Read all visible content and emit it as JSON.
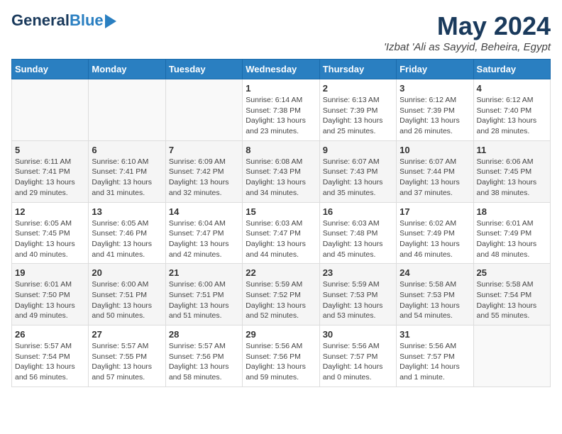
{
  "header": {
    "logo_general": "General",
    "logo_blue": "Blue",
    "month": "May 2024",
    "location": "'Izbat 'Ali as Sayyid, Beheira, Egypt"
  },
  "days_of_week": [
    "Sunday",
    "Monday",
    "Tuesday",
    "Wednesday",
    "Thursday",
    "Friday",
    "Saturday"
  ],
  "weeks": [
    [
      {
        "day": "",
        "info": ""
      },
      {
        "day": "",
        "info": ""
      },
      {
        "day": "",
        "info": ""
      },
      {
        "day": "1",
        "info": "Sunrise: 6:14 AM\nSunset: 7:38 PM\nDaylight: 13 hours\nand 23 minutes."
      },
      {
        "day": "2",
        "info": "Sunrise: 6:13 AM\nSunset: 7:39 PM\nDaylight: 13 hours\nand 25 minutes."
      },
      {
        "day": "3",
        "info": "Sunrise: 6:12 AM\nSunset: 7:39 PM\nDaylight: 13 hours\nand 26 minutes."
      },
      {
        "day": "4",
        "info": "Sunrise: 6:12 AM\nSunset: 7:40 PM\nDaylight: 13 hours\nand 28 minutes."
      }
    ],
    [
      {
        "day": "5",
        "info": "Sunrise: 6:11 AM\nSunset: 7:41 PM\nDaylight: 13 hours\nand 29 minutes."
      },
      {
        "day": "6",
        "info": "Sunrise: 6:10 AM\nSunset: 7:41 PM\nDaylight: 13 hours\nand 31 minutes."
      },
      {
        "day": "7",
        "info": "Sunrise: 6:09 AM\nSunset: 7:42 PM\nDaylight: 13 hours\nand 32 minutes."
      },
      {
        "day": "8",
        "info": "Sunrise: 6:08 AM\nSunset: 7:43 PM\nDaylight: 13 hours\nand 34 minutes."
      },
      {
        "day": "9",
        "info": "Sunrise: 6:07 AM\nSunset: 7:43 PM\nDaylight: 13 hours\nand 35 minutes."
      },
      {
        "day": "10",
        "info": "Sunrise: 6:07 AM\nSunset: 7:44 PM\nDaylight: 13 hours\nand 37 minutes."
      },
      {
        "day": "11",
        "info": "Sunrise: 6:06 AM\nSunset: 7:45 PM\nDaylight: 13 hours\nand 38 minutes."
      }
    ],
    [
      {
        "day": "12",
        "info": "Sunrise: 6:05 AM\nSunset: 7:45 PM\nDaylight: 13 hours\nand 40 minutes."
      },
      {
        "day": "13",
        "info": "Sunrise: 6:05 AM\nSunset: 7:46 PM\nDaylight: 13 hours\nand 41 minutes."
      },
      {
        "day": "14",
        "info": "Sunrise: 6:04 AM\nSunset: 7:47 PM\nDaylight: 13 hours\nand 42 minutes."
      },
      {
        "day": "15",
        "info": "Sunrise: 6:03 AM\nSunset: 7:47 PM\nDaylight: 13 hours\nand 44 minutes."
      },
      {
        "day": "16",
        "info": "Sunrise: 6:03 AM\nSunset: 7:48 PM\nDaylight: 13 hours\nand 45 minutes."
      },
      {
        "day": "17",
        "info": "Sunrise: 6:02 AM\nSunset: 7:49 PM\nDaylight: 13 hours\nand 46 minutes."
      },
      {
        "day": "18",
        "info": "Sunrise: 6:01 AM\nSunset: 7:49 PM\nDaylight: 13 hours\nand 48 minutes."
      }
    ],
    [
      {
        "day": "19",
        "info": "Sunrise: 6:01 AM\nSunset: 7:50 PM\nDaylight: 13 hours\nand 49 minutes."
      },
      {
        "day": "20",
        "info": "Sunrise: 6:00 AM\nSunset: 7:51 PM\nDaylight: 13 hours\nand 50 minutes."
      },
      {
        "day": "21",
        "info": "Sunrise: 6:00 AM\nSunset: 7:51 PM\nDaylight: 13 hours\nand 51 minutes."
      },
      {
        "day": "22",
        "info": "Sunrise: 5:59 AM\nSunset: 7:52 PM\nDaylight: 13 hours\nand 52 minutes."
      },
      {
        "day": "23",
        "info": "Sunrise: 5:59 AM\nSunset: 7:53 PM\nDaylight: 13 hours\nand 53 minutes."
      },
      {
        "day": "24",
        "info": "Sunrise: 5:58 AM\nSunset: 7:53 PM\nDaylight: 13 hours\nand 54 minutes."
      },
      {
        "day": "25",
        "info": "Sunrise: 5:58 AM\nSunset: 7:54 PM\nDaylight: 13 hours\nand 55 minutes."
      }
    ],
    [
      {
        "day": "26",
        "info": "Sunrise: 5:57 AM\nSunset: 7:54 PM\nDaylight: 13 hours\nand 56 minutes."
      },
      {
        "day": "27",
        "info": "Sunrise: 5:57 AM\nSunset: 7:55 PM\nDaylight: 13 hours\nand 57 minutes."
      },
      {
        "day": "28",
        "info": "Sunrise: 5:57 AM\nSunset: 7:56 PM\nDaylight: 13 hours\nand 58 minutes."
      },
      {
        "day": "29",
        "info": "Sunrise: 5:56 AM\nSunset: 7:56 PM\nDaylight: 13 hours\nand 59 minutes."
      },
      {
        "day": "30",
        "info": "Sunrise: 5:56 AM\nSunset: 7:57 PM\nDaylight: 14 hours\nand 0 minutes."
      },
      {
        "day": "31",
        "info": "Sunrise: 5:56 AM\nSunset: 7:57 PM\nDaylight: 14 hours\nand 1 minute."
      },
      {
        "day": "",
        "info": ""
      }
    ]
  ]
}
